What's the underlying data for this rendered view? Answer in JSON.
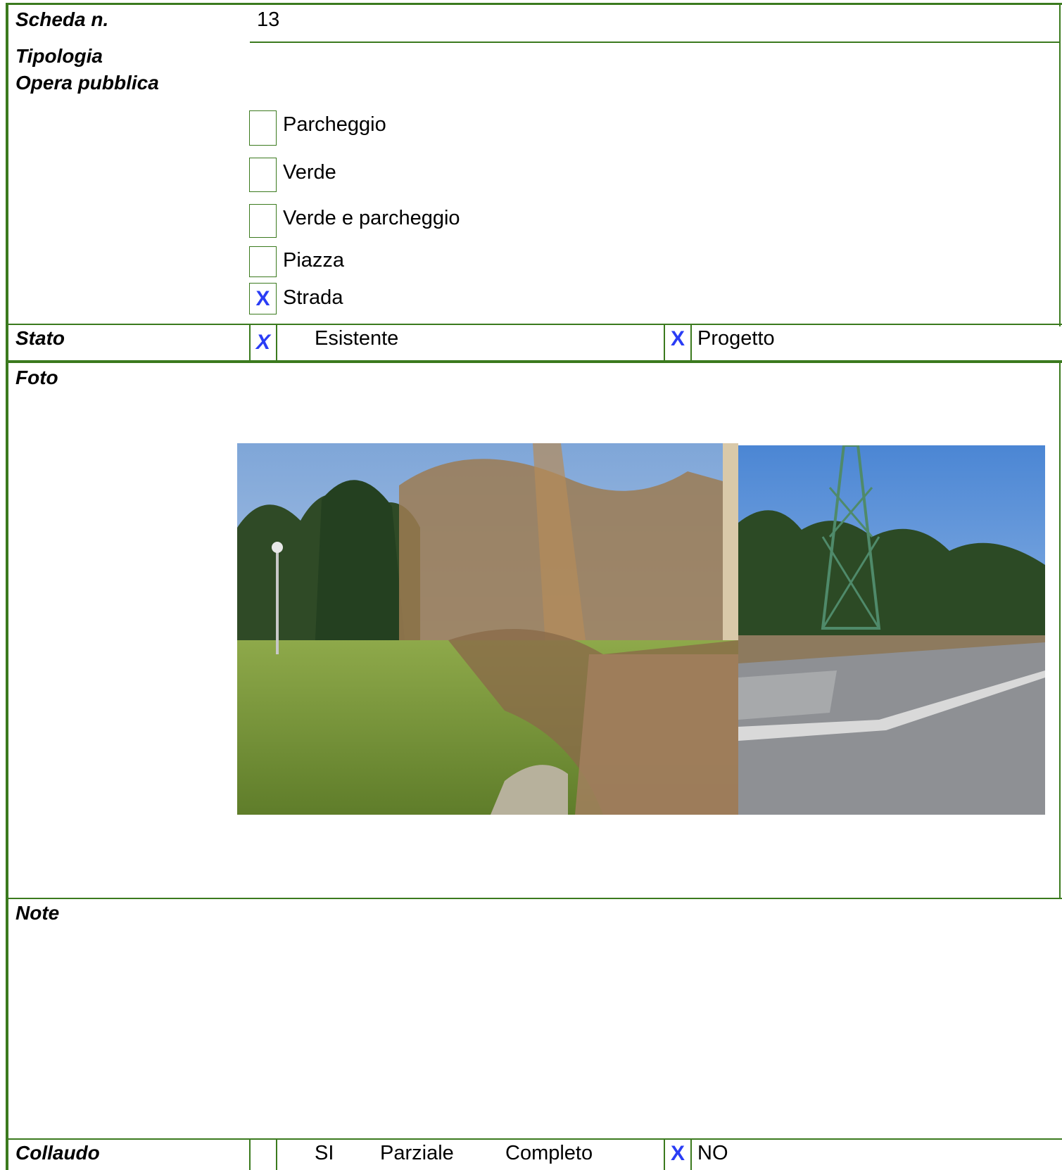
{
  "header": {
    "scheda_label": "Scheda n.",
    "scheda_value": "13"
  },
  "tipologia": {
    "label_line1": "Tipologia",
    "label_line2": "Opera pubblica",
    "options": [
      {
        "label": "Parcheggio",
        "mark": ""
      },
      {
        "label": "Verde",
        "mark": ""
      },
      {
        "label": "Verde e parcheggio",
        "mark": ""
      },
      {
        "label": "Piazza",
        "mark": ""
      },
      {
        "label": "Strada",
        "mark": "X"
      }
    ]
  },
  "stato": {
    "label": "Stato",
    "esistente_mark": "X",
    "esistente_label": "Esistente",
    "progetto_mark": "X",
    "progetto_label": "Progetto"
  },
  "foto": {
    "label": "Foto",
    "photos": [
      "vegetation-field-photo",
      "road-pylon-photo"
    ]
  },
  "note": {
    "label": "Note"
  },
  "collaudo": {
    "label": "Collaudo",
    "si_mark": "",
    "si_label": "SI",
    "parziale_label": "Parziale",
    "completo_label": "Completo",
    "no_mark": "X",
    "no_label": "NO"
  },
  "colors": {
    "border": "#3b7a1e",
    "mark": "#2a3df5"
  }
}
